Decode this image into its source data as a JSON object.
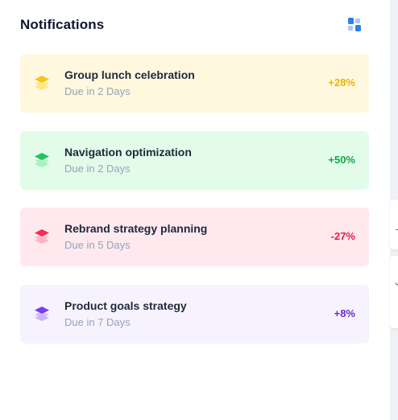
{
  "header": {
    "title": "Notifications",
    "grid_icon": "grid-layout-icon"
  },
  "notifications": [
    {
      "title": "Group lunch celebration",
      "due": "Due in 2 Days",
      "change": "+28%",
      "icon": "layers-icon",
      "bg": "#fff8df",
      "accent": "#f5c518",
      "accent_light": "#fde68a",
      "change_color": "#eab308"
    },
    {
      "title": "Navigation optimization",
      "due": "Due in 2 Days",
      "change": "+50%",
      "icon": "layers-icon",
      "bg": "#e3fcea",
      "accent": "#22c55e",
      "accent_light": "#a7f0c0",
      "change_color": "#16a34a"
    },
    {
      "title": "Rebrand strategy planning",
      "due": "Due in 5 Days",
      "change": "-27%",
      "icon": "layers-icon",
      "bg": "#ffe9ef",
      "accent": "#ef2f5b",
      "accent_light": "#fbb4c6",
      "change_color": "#e11d48"
    },
    {
      "title": "Product goals strategy",
      "due": "Due in 7 Days",
      "change": "+8%",
      "icon": "layers-icon",
      "bg": "#f6f3ff",
      "accent": "#7c3aed",
      "accent_light": "#c9b6f7",
      "change_color": "#6d28d9"
    }
  ]
}
